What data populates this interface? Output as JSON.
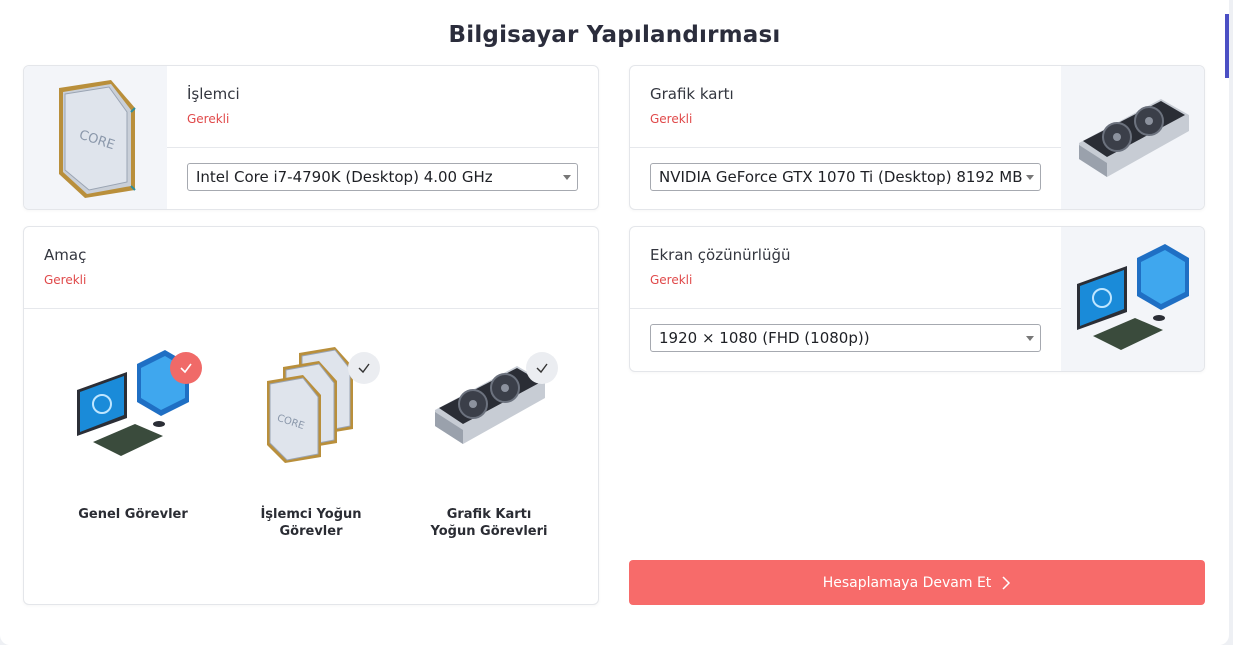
{
  "title": "Bilgisayar Yapılandırması",
  "required_text": "Gerekli",
  "cpu": {
    "label": "İşlemci",
    "selected": "Intel Core i7-4790K (Desktop) 4.00 GHz",
    "chip_text": "CORE"
  },
  "gpu": {
    "label": "Grafik kartı",
    "selected": "NVIDIA GeForce GTX 1070 Ti (Desktop) 8192 MB"
  },
  "resolution": {
    "label": "Ekran çözünürlüğü",
    "selected": "1920 × 1080 (FHD (1080p))"
  },
  "purpose": {
    "label": "Amaç",
    "options": [
      {
        "label_line1": "Genel Görevler",
        "label_line2": "",
        "selected": true
      },
      {
        "label_line1": "İşlemci Yoğun",
        "label_line2": "Görevler",
        "selected": false
      },
      {
        "label_line1": "Grafik Kartı",
        "label_line2": "Yoğun Görevleri",
        "selected": false
      }
    ]
  },
  "cta": {
    "label": "Hesaplamaya Devam Et"
  },
  "colors": {
    "accent": "#f76b6a",
    "required": "#e0494a",
    "brand_bar": "#4b4fc4"
  }
}
